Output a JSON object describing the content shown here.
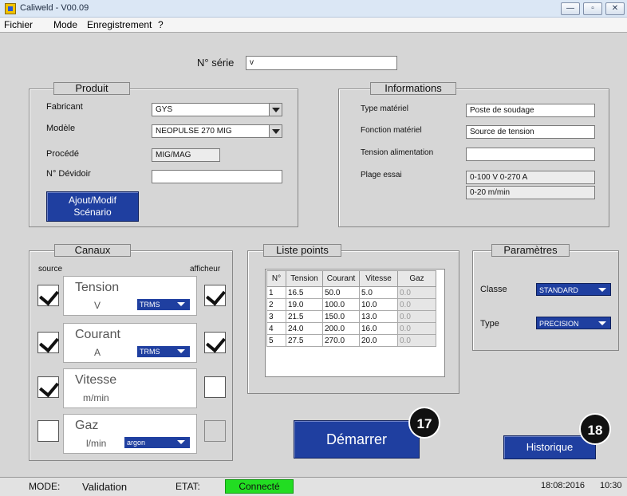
{
  "window": {
    "title": "Caliweld - V00.09",
    "minimize": "—",
    "maximize": "▫",
    "close": "✕"
  },
  "menu": [
    "Fichier",
    "Mode",
    "Enregistrement",
    "?"
  ],
  "serie": {
    "label": "N° série",
    "value": "v"
  },
  "produit": {
    "title": "Produit",
    "fabricant_label": "Fabricant",
    "fabricant_value": "GYS",
    "modele_label": "Modèle",
    "modele_value": "NEOPULSE 270 MIG",
    "procede_label": "Procédé",
    "procede_value": "MIG/MAG",
    "devidoir_label": "N° Dévidoir",
    "devidoir_value": "",
    "scenario_line1": "Ajout/Modif",
    "scenario_line2": "Scénario"
  },
  "informations": {
    "title": "Informations",
    "type_label": "Type matériel",
    "type_value": "Poste de soudage",
    "fonction_label": "Fonction matériel",
    "fonction_value": "Source de tension",
    "tension_label": "Tension alimentation",
    "tension_value": "",
    "plage_label": "Plage essai",
    "plage_value1": "0-100 V 0-270 A",
    "plage_value2": "0-20 m/min"
  },
  "canaux": {
    "title": "Canaux",
    "source_label": "source",
    "afficheur_label": "afficheur",
    "channels": [
      {
        "name": "Tension",
        "unit": "V",
        "select": "TRMS",
        "source": true,
        "afficheur": true
      },
      {
        "name": "Courant",
        "unit": "A",
        "select": "TRMS",
        "source": true,
        "afficheur": true
      },
      {
        "name": "Vitesse",
        "unit": "m/min",
        "select": "",
        "source": true,
        "afficheur": false
      },
      {
        "name": "Gaz",
        "unit": "l/min",
        "select": "argon",
        "source": false,
        "afficheur": false
      }
    ]
  },
  "liste": {
    "title": "Liste points",
    "headers": [
      "N°",
      "Tension",
      "Courant",
      "Vitesse",
      "Gaz"
    ],
    "rows": [
      [
        "1",
        "16.5",
        "50.0",
        "5.0",
        "0.0"
      ],
      [
        "2",
        "19.0",
        "100.0",
        "10.0",
        "0.0"
      ],
      [
        "3",
        "21.5",
        "150.0",
        "13.0",
        "0.0"
      ],
      [
        "4",
        "24.0",
        "200.0",
        "16.0",
        "0.0"
      ],
      [
        "5",
        "27.5",
        "270.0",
        "20.0",
        "0.0"
      ]
    ]
  },
  "parametres": {
    "title": "Paramètres",
    "classe_label": "Classe",
    "classe_value": "STANDARD",
    "type_label": "Type",
    "type_value": "PRECISION"
  },
  "buttons": {
    "demarrer": "Démarrer",
    "historique": "Historique"
  },
  "badges": {
    "b17": "17",
    "b18": "18"
  },
  "status": {
    "mode_label": "MODE:",
    "mode_value": "Validation",
    "etat_label": "ETAT:",
    "etat_value": "Connecté",
    "date": "18:08:2016",
    "time": "10:30"
  },
  "colors": {
    "accent": "#1f3fa0",
    "connected": "#22dd22",
    "panel": "#d6d6d6"
  }
}
